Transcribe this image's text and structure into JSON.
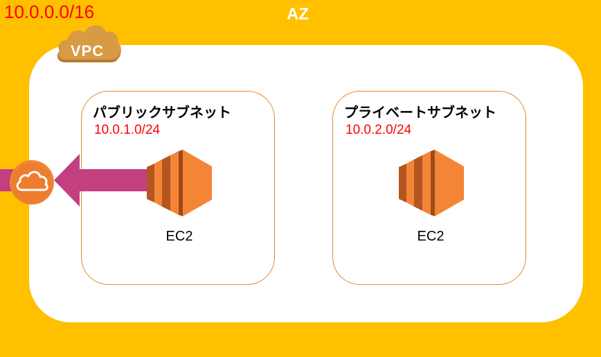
{
  "az": {
    "label": "AZ",
    "color": "#FFC000"
  },
  "vpc": {
    "cidr": "10.0.0.0/16",
    "icon_label": "VPC",
    "icon": "vpc-cloud-icon"
  },
  "public_subnet": {
    "title": "パブリックサブネット",
    "cidr": "10.0.1.0/24",
    "instance": {
      "label": "EC2",
      "icon": "ec2-icon"
    }
  },
  "private_subnet": {
    "title": "プライベートサブネット",
    "cidr": "10.0.2.0/24",
    "instance": {
      "label": "EC2",
      "icon": "ec2-icon"
    }
  },
  "internet_gateway": {
    "icon": "internet-gateway-cloud-icon"
  },
  "colors": {
    "az_background": "#FFC000",
    "cidr_text": "#FF0000",
    "subnet_border": "#E8892B",
    "ec2_orange": "#F58536",
    "arrow": "#C2407F"
  }
}
